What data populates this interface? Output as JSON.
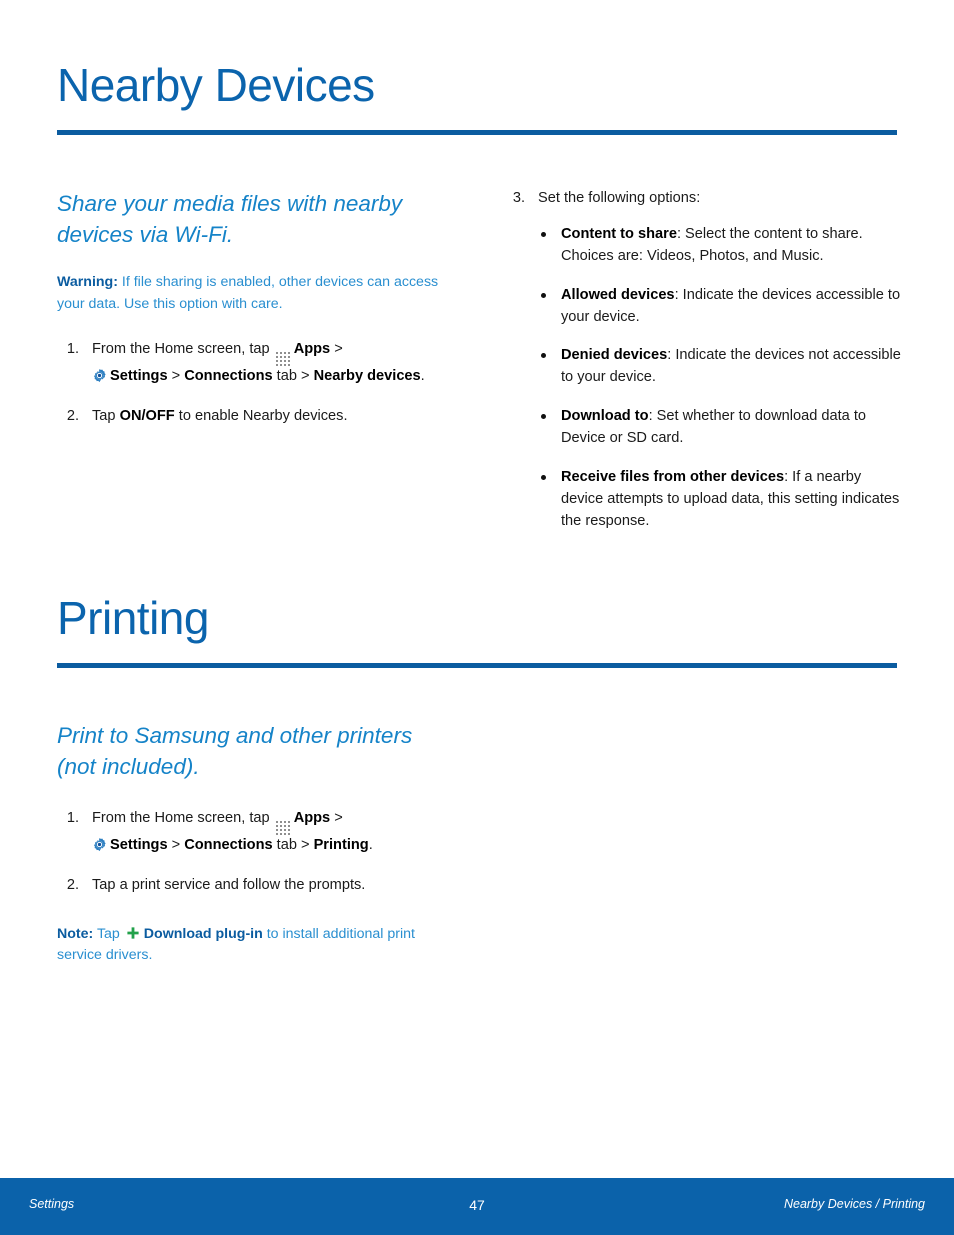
{
  "document": {
    "sections": [
      {
        "id": "nearby-devices",
        "title": "Nearby Devices",
        "subhead": "Share your media files with nearby devices via Wi-Fi.",
        "warning": {
          "label": "Warning:",
          "text": " If file sharing is enabled, other devices can access your data. Use this option with care."
        },
        "steps": [
          {
            "num": "1.",
            "pre": "From the Home screen, tap ",
            "apps_label": "Apps",
            "mid1": " > ",
            "settings_label": "Settings",
            "mid2": " > ",
            "connections_label": "Connections",
            "mid3": " tab > ",
            "target_label": "Nearby devices",
            "post": "."
          },
          {
            "num": "2.",
            "pre": "Tap ",
            "bold": "ON/OFF",
            "post": " to enable Nearby devices."
          },
          {
            "num": "3.",
            "text": "Set the following options:"
          }
        ],
        "options": [
          {
            "label": "Content to share",
            "text": ": Select the content to share. Choices are: Videos, Photos, and Music."
          },
          {
            "label": "Allowed devices",
            "text": ": Indicate the devices accessible to your device."
          },
          {
            "label": "Denied devices",
            "text": ": Indicate the devices not accessible to your device."
          },
          {
            "label": "Download to",
            "text": ": Set whether to download data to Device or SD card."
          },
          {
            "label": "Receive files from other devices",
            "text": ": If a nearby device attempts to upload data, this setting indicates the response."
          }
        ]
      },
      {
        "id": "printing",
        "title": "Printing",
        "subhead": "Print to Samsung and other printers (not included).",
        "steps": [
          {
            "num": "1.",
            "pre": "From the Home screen, tap ",
            "apps_label": "Apps",
            "mid1": " > ",
            "settings_label": "Settings",
            "mid2": " > ",
            "connections_label": "Connections",
            "mid3": " tab > ",
            "target_label": "Printing",
            "post": "."
          },
          {
            "num": "2.",
            "text": "Tap a print service and follow the prompts."
          }
        ],
        "note": {
          "label": "Note:",
          "pre": " Tap ",
          "link": "Download plug-in",
          "post": " to install additional print service drivers."
        }
      }
    ]
  },
  "icons": {
    "apps": "apps-grid-icon",
    "settings": "gear-icon",
    "download_plugin": "plus-icon"
  },
  "colors": {
    "heading_blue": "#0b64ad",
    "rule_blue": "#0b5ca0",
    "subhead_blue": "#1583c8",
    "callout_blue": "#2a8fd0",
    "callout_bold_blue": "#0b5ca0",
    "footer_bg": "#0b62aa",
    "plus_green": "#22a14a",
    "body_text": "#1a1a1a"
  },
  "footer": {
    "left": "Settings",
    "page_number": "47",
    "right": "Nearby Devices / Printing"
  }
}
